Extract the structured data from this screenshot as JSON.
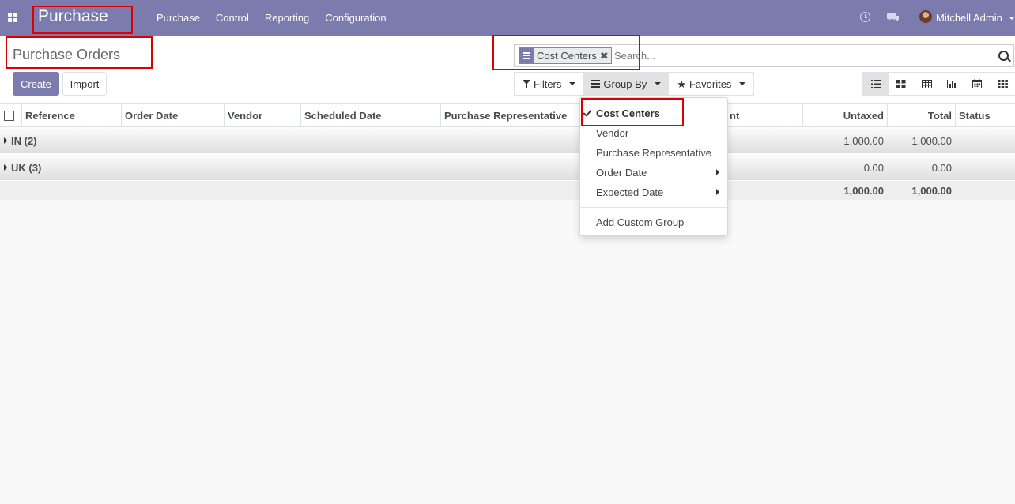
{
  "navbar": {
    "app_name": "Purchase",
    "menu": [
      "Purchase",
      "Control",
      "Reporting",
      "Configuration"
    ],
    "user_name": "Mitchell Admin",
    "color": "#7c7bad"
  },
  "control_panel": {
    "breadcrumb": "Purchase Orders",
    "create_label": "Create",
    "import_label": "Import",
    "search": {
      "facet_label": "Cost Centers",
      "placeholder": "Search..."
    },
    "filters_label": "Filters",
    "group_by_label": "Group By",
    "favorites_label": "Favorites",
    "views": [
      "list",
      "kanban",
      "pivot",
      "graph",
      "calendar",
      "grid"
    ]
  },
  "table": {
    "columns": [
      "Reference",
      "Order Date",
      "Vendor",
      "Scheduled Date",
      "Purchase Representative",
      "nt",
      "Untaxed",
      "Total",
      "Status"
    ],
    "groups": [
      {
        "label": "IN (2)",
        "untaxed": "1,000.00",
        "total": "1,000.00"
      },
      {
        "label": "UK (3)",
        "untaxed": "0.00",
        "total": "0.00"
      }
    ],
    "footer": {
      "untaxed": "1,000.00",
      "total": "1,000.00"
    }
  },
  "group_by_menu": {
    "items": [
      {
        "label": "Cost Centers",
        "selected": true
      },
      {
        "label": "Vendor"
      },
      {
        "label": "Purchase Representative"
      },
      {
        "label": "Order Date",
        "submenu": true
      },
      {
        "label": "Expected Date",
        "submenu": true
      }
    ],
    "add_custom": "Add Custom Group"
  }
}
